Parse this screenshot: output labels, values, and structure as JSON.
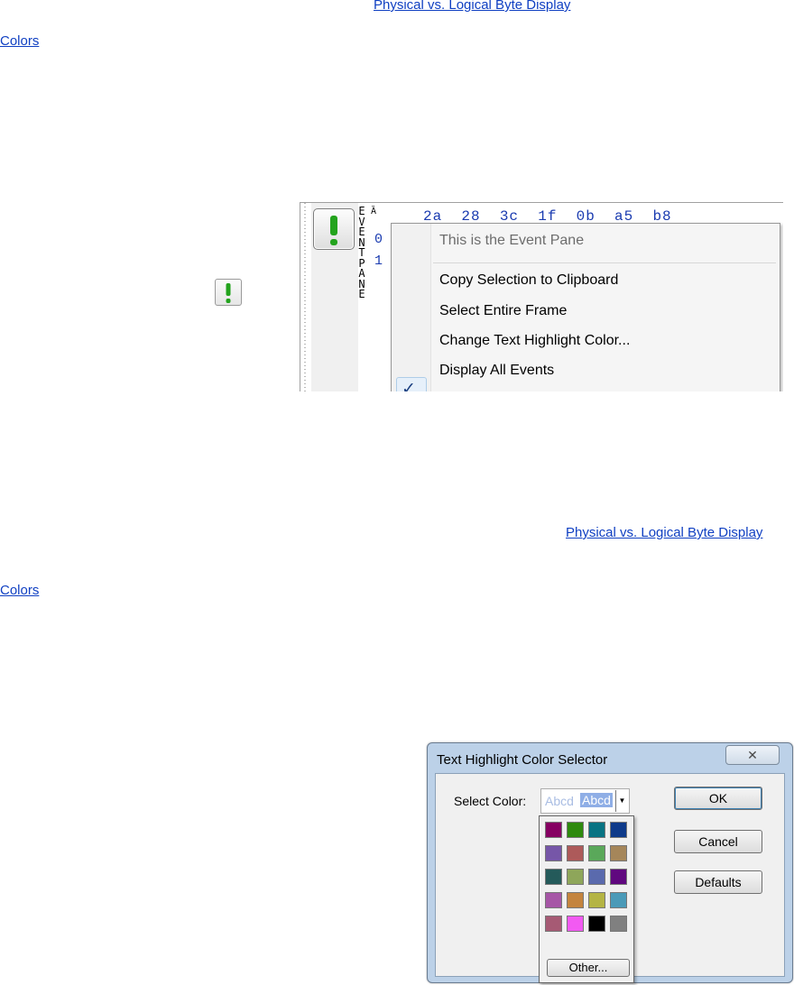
{
  "doc": {
    "link_top": "Physical vs. Logical Byte Display",
    "colors_top": "Colors",
    "link_bottom": "Physical vs. Logical Byte Display",
    "colors_bottom": "Colors"
  },
  "event_pane": {
    "vertical_label": "EVENT PANE",
    "hex_header": "2a  28  3c  1f  0b  a5  b8",
    "row_numbers": [
      "0",
      "1"
    ],
    "menu": {
      "title": "This is the Event Pane",
      "items": [
        {
          "label": "Copy Selection to Clipboard",
          "checked": false
        },
        {
          "label": "Select Entire Frame",
          "checked": false
        },
        {
          "label": "Change Text Highlight Color...",
          "checked": false
        },
        {
          "label": "Display All Events",
          "checked": true
        }
      ]
    },
    "icon_color": "#23a31d"
  },
  "dialog": {
    "title": "Text Highlight Color Selector",
    "close_label": "✕",
    "select_label": "Select Color:",
    "sample_text": "Abcd",
    "sample_highlight": "Abcd",
    "ok_label": "OK",
    "cancel_label": "Cancel",
    "defaults_label": "Defaults",
    "other_label": "Other...",
    "swatches": [
      "#860062",
      "#2e8a0e",
      "#087383",
      "#0e3a8a",
      "#7656a8",
      "#ad5a5a",
      "#5aa85a",
      "#a5865a",
      "#245a5a",
      "#8ea65a",
      "#5a6aad",
      "#60087f",
      "#a656a6",
      "#c4843e",
      "#b4b444",
      "#4a9ab8",
      "#a65a74",
      "#f25af2",
      "#000000",
      "#808080"
    ]
  }
}
